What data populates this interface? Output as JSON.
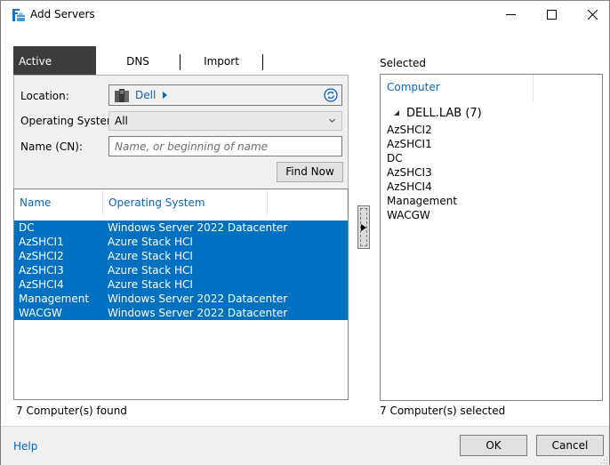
{
  "window": {
    "title": "Add Servers",
    "icon": "server-manager-icon",
    "controls": [
      "minimize-icon",
      "maximize-icon",
      "close-icon"
    ]
  },
  "tabs": [
    {
      "label": "Active Directory",
      "active": true
    },
    {
      "label": "DNS",
      "active": false
    },
    {
      "label": "Import",
      "active": false
    }
  ],
  "search": {
    "location_label": "Location:",
    "location_value": "Dell",
    "os_label": "Operating System:",
    "os_value": "All",
    "name_label": "Name (CN):",
    "name_value": "",
    "name_placeholder": "Name, or beginning of name",
    "find_button": "Find Now"
  },
  "results": {
    "columns": [
      "Name",
      "Operating System"
    ],
    "rows": [
      {
        "name": "DC",
        "os": "Windows Server 2022 Datacenter",
        "selected": true
      },
      {
        "name": "AzSHCI1",
        "os": "Azure Stack HCI",
        "selected": true
      },
      {
        "name": "AzSHCI2",
        "os": "Azure Stack HCI",
        "selected": true
      },
      {
        "name": "AzSHCI3",
        "os": "Azure Stack HCI",
        "selected": true
      },
      {
        "name": "AzSHCI4",
        "os": "Azure Stack HCI",
        "selected": true
      },
      {
        "name": "Management",
        "os": "Windows Server 2022 Datacenter",
        "selected": true
      },
      {
        "name": "WACGW",
        "os": "Windows Server 2022 Datacenter",
        "selected": true
      }
    ],
    "status": "7 Computer(s) found"
  },
  "selected": {
    "title": "Selected",
    "column": "Computer",
    "group": "DELL.LAB (7)",
    "items": [
      "AzSHCI2",
      "AzSHCI1",
      "DC",
      "AzSHCI3",
      "AzSHCI4",
      "Management",
      "WACGW"
    ],
    "status": "7 Computer(s) selected"
  },
  "footer": {
    "help": "Help",
    "ok": "OK",
    "cancel": "Cancel"
  },
  "colors": {
    "accent": "#0a65b8",
    "selection": "#0070c0",
    "active_tab": "#3c3c3c"
  }
}
